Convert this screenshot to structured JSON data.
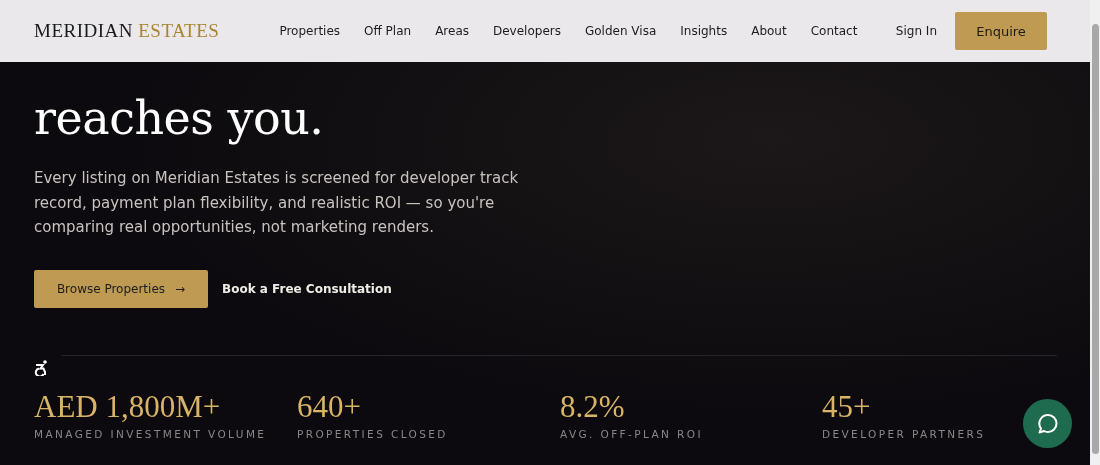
{
  "nav": {
    "logo": {
      "primary": "MERIDIAN",
      "accent": "ESTATES"
    },
    "links": [
      {
        "label": "Properties"
      },
      {
        "label": "Off Plan"
      },
      {
        "label": "Areas"
      },
      {
        "label": "Developers"
      },
      {
        "label": "Golden Visa"
      },
      {
        "label": "Insights"
      },
      {
        "label": "About"
      },
      {
        "label": "Contact"
      }
    ],
    "sign_in": "Sign In",
    "cta": "Enquire"
  },
  "hero": {
    "headline_lines": [
      "reaches you."
    ],
    "body": "Every listing on Meridian Estates is screened for developer track record, payment plan flexibility, and realistic ROI — so you're comparing real opportunities, not marketing renders.",
    "primary_button": {
      "label": "Browse Properties",
      "arrow": "→"
    },
    "secondary_button": {
      "label": "Book a Free Consultation"
    }
  },
  "stats": [
    {
      "value": "AED 1,800M+",
      "label": "MANAGED INVESTMENT VOLUME"
    },
    {
      "value": "640+",
      "label": "PROPERTIES CLOSED"
    },
    {
      "value": "8.2%",
      "label": "AVG. OFF-PLAN ROI"
    },
    {
      "value": "45+",
      "label": "DEVELOPER PARTNERS"
    }
  ]
}
